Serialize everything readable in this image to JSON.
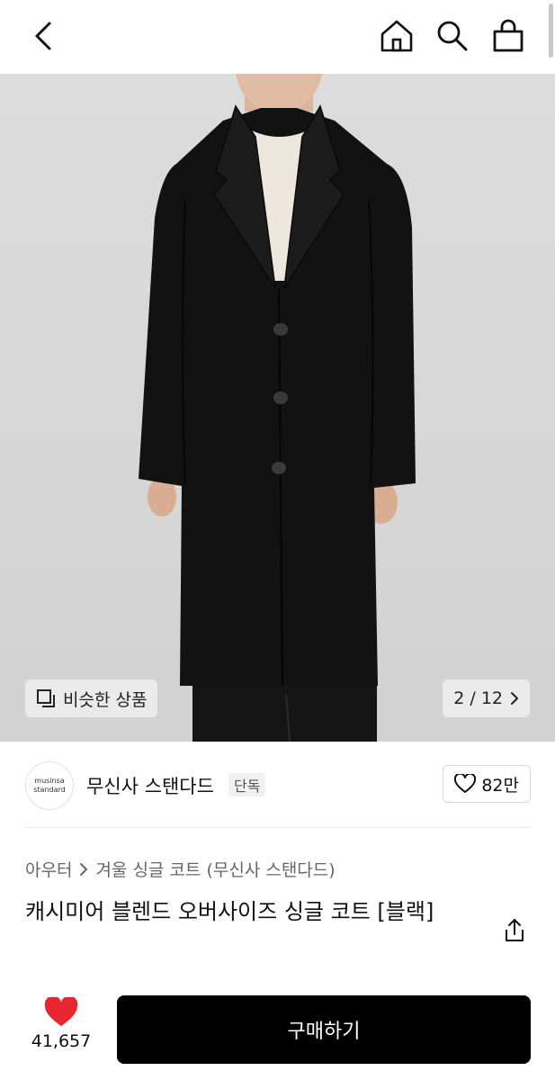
{
  "header": {
    "back_icon": "chevron-left-icon",
    "icons": [
      "home-icon",
      "search-icon",
      "shopping-bag-icon"
    ]
  },
  "gallery": {
    "similar_label": "비슷한 상품",
    "counter": "2 / 12"
  },
  "brand": {
    "logo_line1": "musinsa",
    "logo_line2": "standard",
    "name": "무신사 스탠다드",
    "badge": "단독",
    "likes": "82만"
  },
  "product": {
    "category_1": "아우터",
    "category_2": "겨울 싱글 코트 (무신사 스탠다드)",
    "title": "캐시미어 블렌드 오버사이즈 싱글 코트 [블랙]"
  },
  "bottom": {
    "wish_count": "41,657",
    "buy_label": "구매하기"
  },
  "colors": {
    "accent_heart": "#e8262f",
    "buy_button": "#000000"
  }
}
